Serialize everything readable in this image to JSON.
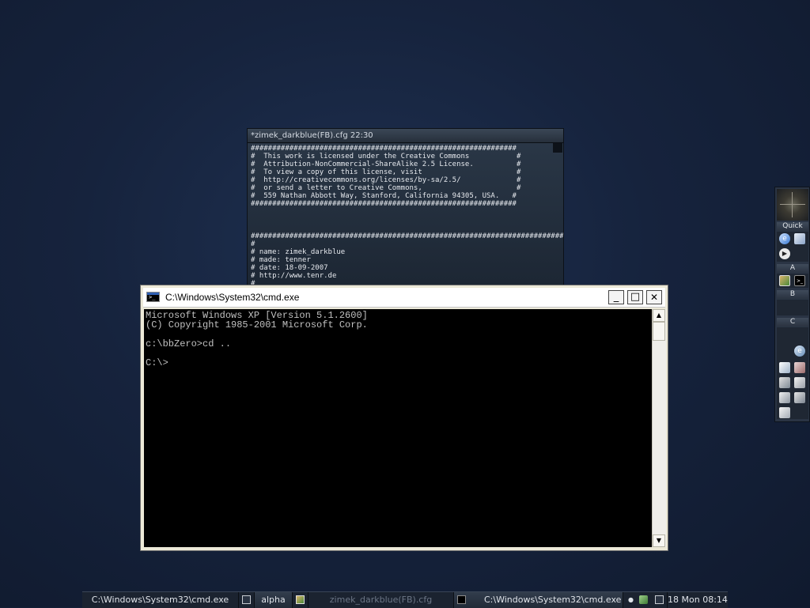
{
  "editor": {
    "title": "*zimek_darkblue(FB).cfg  22:30",
    "license_lines": [
      "##############################################################",
      "#  This work is licensed under the Creative Commons           #",
      "#  Attribution-NonCommercial-ShareAlike 2.5 License.          #",
      "#  To view a copy of this license, visit                      #",
      "#  http://creativecommons.org/licenses/by-sa/2.5/             #",
      "#  or send a letter to Creative Commons,                      #",
      "#  559 Nathan Abbott Way, Stanford, California 94305, USA.   #",
      "##############################################################"
    ],
    "meta_lines": [
      "###############################################################################",
      "#",
      "# name: zimek_darkblue",
      "# made: tenner",
      "# date: 18-09-2007",
      "# http://www.tenr.de",
      "#"
    ]
  },
  "cmd": {
    "title": "C:\\Windows\\System32\\cmd.exe",
    "minimize": "_",
    "maximize": "□",
    "close": "✕",
    "lines": [
      "Microsoft Windows XP [Version 5.1.2600]",
      "(C) Copyright 1985-2001 Microsoft Corp.",
      "",
      "c:\\bbZero>cd ..",
      "",
      "C:\\>"
    ],
    "scroll_up": "▲",
    "scroll_down": "▼"
  },
  "slit": {
    "headers": {
      "quick": "Quick",
      "a": "A",
      "b": "B",
      "c": "C"
    },
    "icons": {
      "quick": [
        "internet-explorer-icon",
        "network-icon",
        "media-player-icon"
      ],
      "a": [
        "image-editor-icon",
        "console-icon"
      ],
      "c": [
        "internet-explorer-icon",
        "accessibility-icon",
        "magnifier-icon",
        "trash-icon",
        "printer-icon",
        "computer-icon",
        "sound-icon",
        "recycle-bin-icon"
      ]
    }
  },
  "taskbar": {
    "task_cmd_1": "C:\\Windows\\System32\\cmd.exe",
    "workspace": "alpha",
    "task_editor": "zimek_darkblue(FB).cfg",
    "task_cmd_2": "C:\\Windows\\System32\\cmd.exe",
    "clock": "18 Mon 08:14"
  },
  "colors": {
    "desktop": "#16233d",
    "console_bg": "#000000",
    "console_text": "#c0c0c0",
    "taskbar_bg": "#1b2330"
  }
}
